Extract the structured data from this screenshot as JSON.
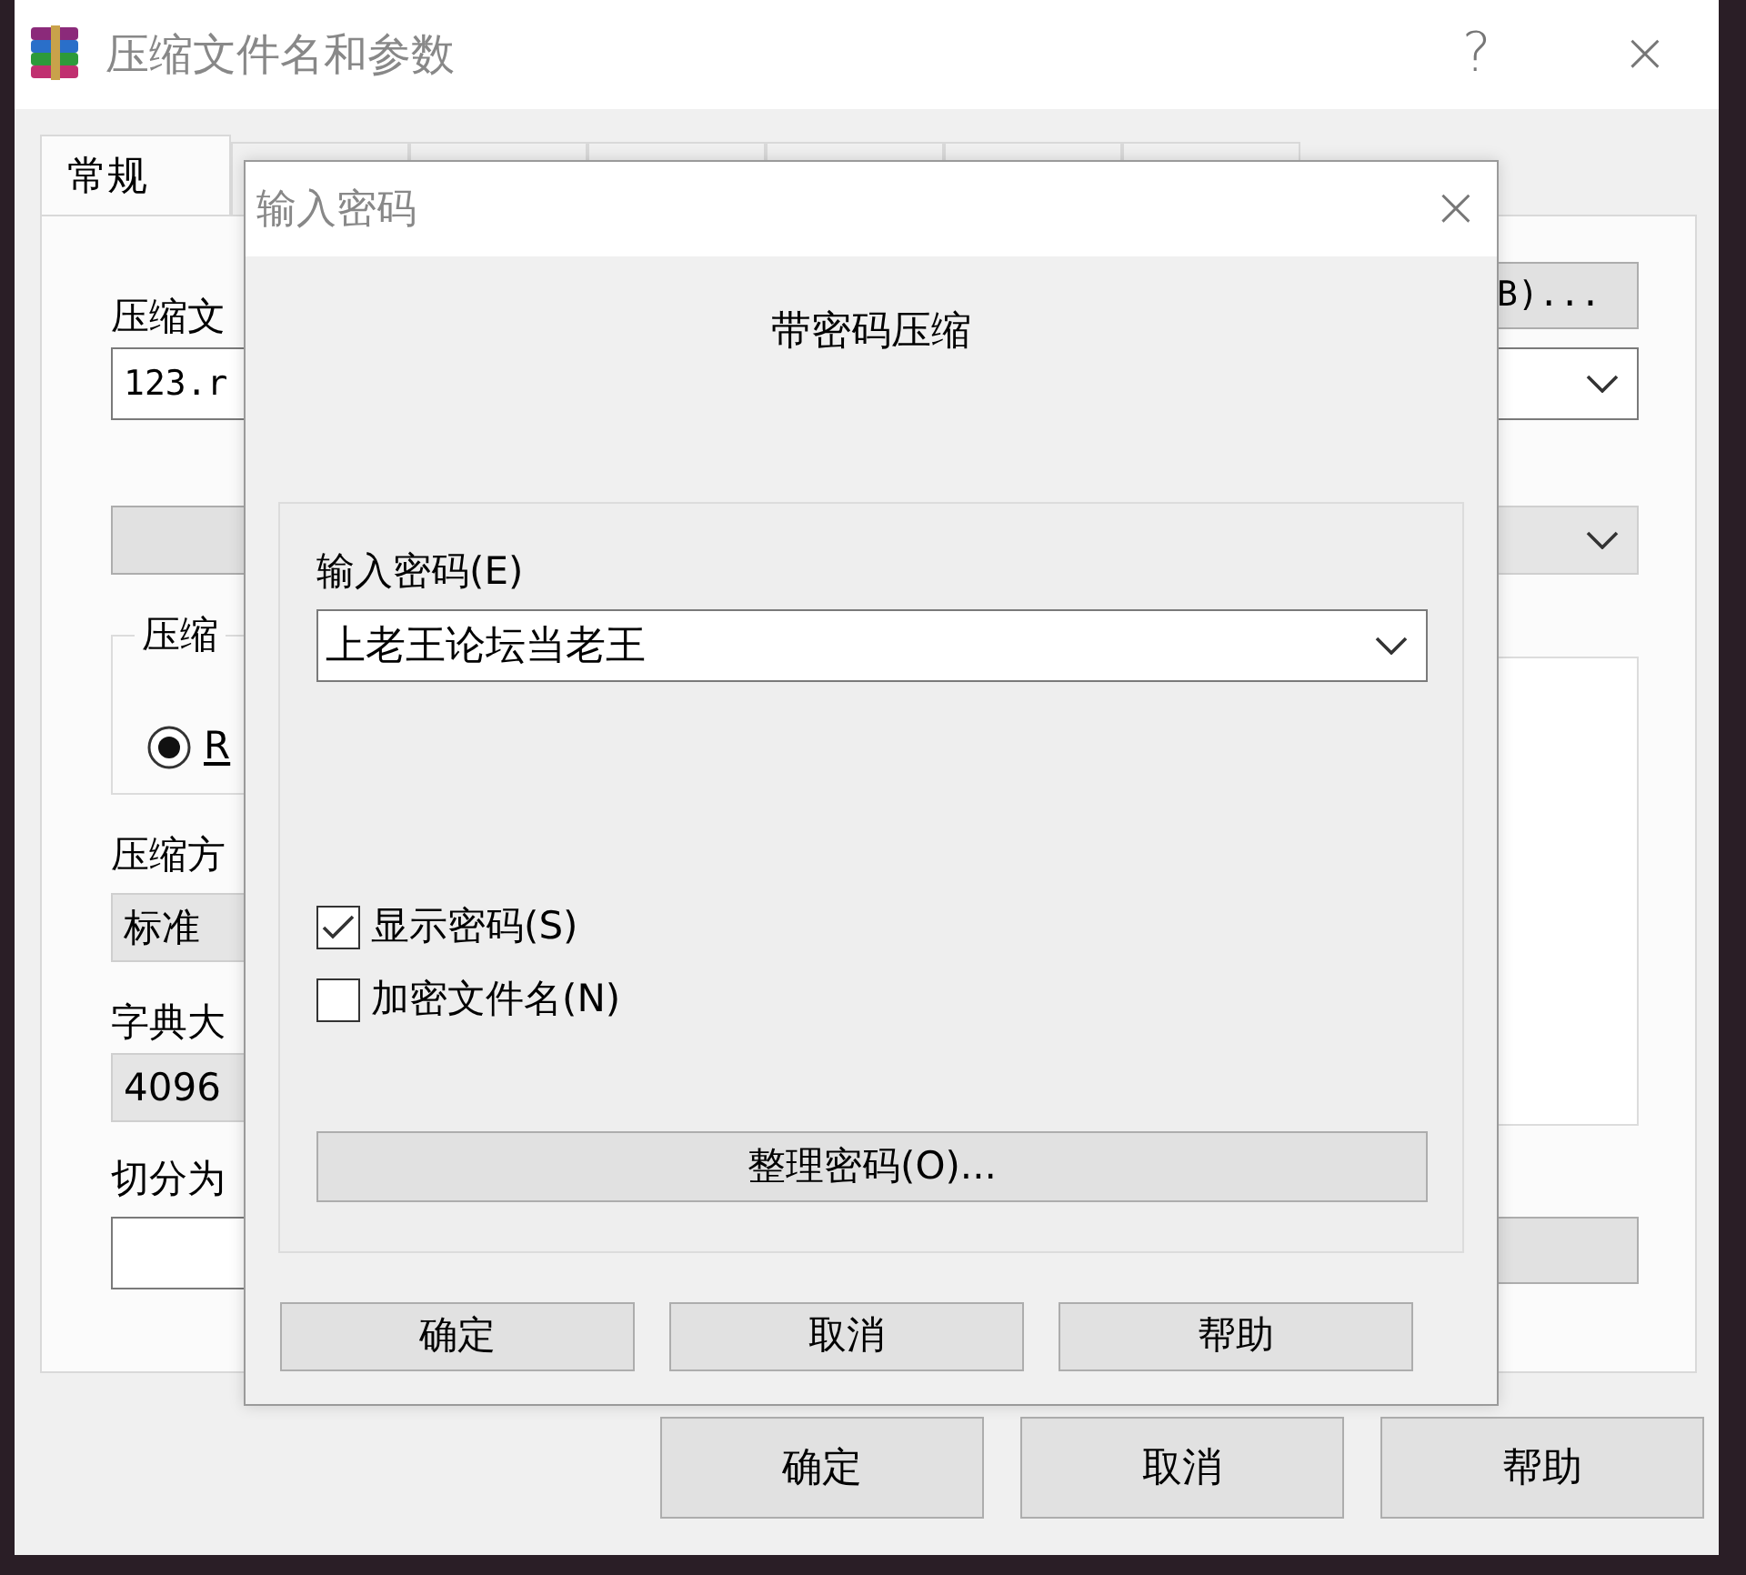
{
  "window": {
    "title": "压缩文件名和参数",
    "help_glyph": "?",
    "close_glyph": "×"
  },
  "tabs": [
    {
      "label": "常规",
      "selected": true
    },
    {
      "selected": false
    },
    {
      "selected": false
    },
    {
      "selected": false
    },
    {
      "selected": false
    },
    {
      "selected": false
    },
    {
      "selected": false
    }
  ],
  "left_column": [
    {
      "kind": "label",
      "text": "压缩文"
    },
    {
      "kind": "field",
      "value": "123.r"
    },
    {
      "kind": "button"
    },
    {
      "kind": "group",
      "legend": "压缩",
      "option": {
        "label": "R",
        "selected": true
      }
    },
    {
      "kind": "label",
      "text": "压缩方"
    },
    {
      "kind": "dropdown",
      "value": "标准"
    },
    {
      "kind": "label",
      "text": "字典大"
    },
    {
      "kind": "dropdown",
      "value": "4096"
    },
    {
      "kind": "label",
      "text": "切分为"
    },
    {
      "kind": "field"
    }
  ],
  "right_column": [
    {
      "kind": "button",
      "label": "B)..."
    },
    {
      "kind": "combo"
    },
    {
      "kind": "dropdown"
    },
    {
      "kind": "panel"
    },
    {
      "kind": "button"
    }
  ],
  "buttons": [
    "确定",
    "取消",
    "帮助"
  ],
  "dialog": {
    "title": "输入密码",
    "close_glyph": "×",
    "heading": "带密码压缩",
    "password_label": "输入密码(E)",
    "password": "上老王论坛当老王",
    "checkboxes": [
      {
        "label": "显示密码(S)",
        "checked": true
      },
      {
        "label": "加密文件名(N)",
        "checked": false
      }
    ],
    "manage_button": "整理密码(O)...",
    "buttons": [
      "确定",
      "取消",
      "帮助"
    ]
  }
}
